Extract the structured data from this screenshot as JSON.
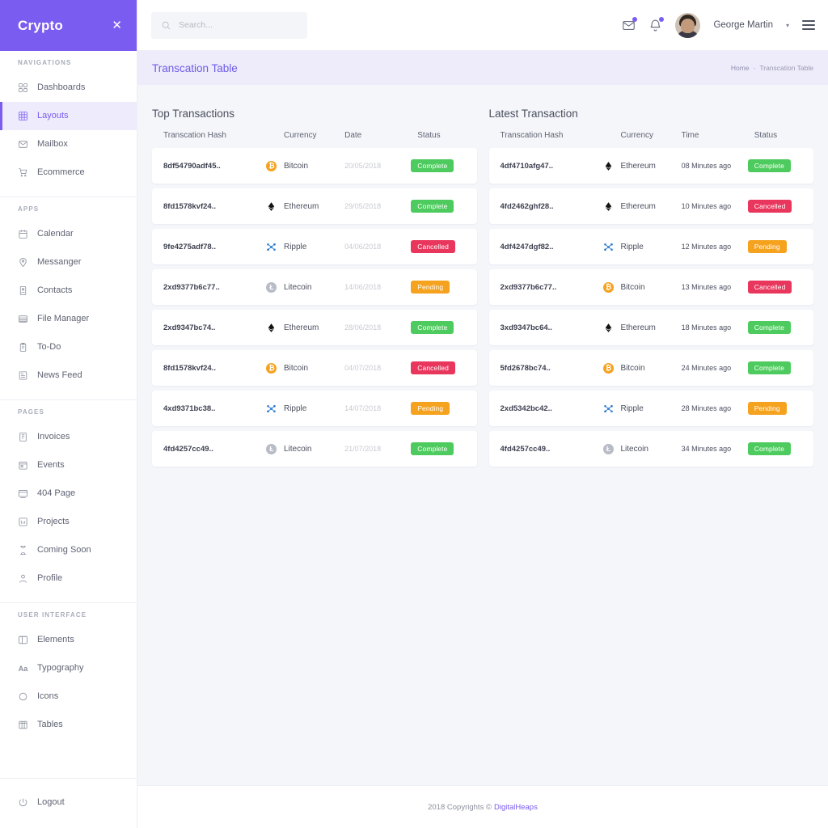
{
  "brand": {
    "name": "Crypto",
    "close_icon": "close-icon"
  },
  "sidebar": {
    "sections": [
      {
        "heading": "NAVIGATIONS",
        "items": [
          {
            "label": "Dashboards",
            "icon": "grid-icon",
            "active": false
          },
          {
            "label": "Layouts",
            "icon": "layout-grid-icon",
            "active": true
          },
          {
            "label": "Mailbox",
            "icon": "envelope-icon",
            "active": false
          },
          {
            "label": "Ecommerce",
            "icon": "cart-icon",
            "active": false
          }
        ]
      },
      {
        "heading": "APPS",
        "items": [
          {
            "label": "Calendar",
            "icon": "calendar-icon",
            "active": false
          },
          {
            "label": "Messanger",
            "icon": "chat-pin-icon",
            "active": false
          },
          {
            "label": "Contacts",
            "icon": "contact-card-icon",
            "active": false
          },
          {
            "label": "File Manager",
            "icon": "folder-lines-icon",
            "active": false
          },
          {
            "label": "To-Do",
            "icon": "clipboard-icon",
            "active": false
          },
          {
            "label": "News Feed",
            "icon": "news-icon",
            "active": false
          }
        ]
      },
      {
        "heading": "PAGES",
        "items": [
          {
            "label": "Invoices",
            "icon": "invoice-icon",
            "active": false
          },
          {
            "label": "Events",
            "icon": "events-icon",
            "active": false
          },
          {
            "label": "404 Page",
            "icon": "browser-error-icon",
            "active": false
          },
          {
            "label": "Projects",
            "icon": "projects-icon",
            "active": false
          },
          {
            "label": "Coming Soon",
            "icon": "hourglass-icon",
            "active": false
          },
          {
            "label": "Profile",
            "icon": "user-icon",
            "active": false
          }
        ]
      },
      {
        "heading": "USER INTERFACE",
        "items": [
          {
            "label": "Elements",
            "icon": "elements-icon",
            "active": false
          },
          {
            "label": "Typography",
            "icon": "typography-aa-icon",
            "active": false
          },
          {
            "label": "Icons",
            "icon": "circle-icon",
            "active": false
          },
          {
            "label": "Tables",
            "icon": "table-icon",
            "active": false
          }
        ]
      }
    ],
    "logout": {
      "label": "Logout",
      "icon": "power-icon"
    }
  },
  "header": {
    "search": {
      "placeholder": "Search...",
      "value": "",
      "icon": "search-icon"
    },
    "mail_icon": "envelope-icon",
    "bell_icon": "bell-icon",
    "user_name": "George Martin",
    "caret": "▾",
    "menu_icon": "hamburger-icon",
    "avatar": "avatar"
  },
  "breadcrumb": {
    "title": "Transcation Table",
    "home": "Home",
    "separator": "-",
    "current": "Transcation Table"
  },
  "left_table": {
    "title": "Top Transactions",
    "columns": [
      "Transcation Hash",
      "Currency",
      "Date",
      "Status"
    ],
    "rows": [
      {
        "hash": "8df54790adf45..",
        "currency": "Bitcoin",
        "coin": "btc",
        "date": "20/05/2018",
        "status": "Complete",
        "status_kind": "complete"
      },
      {
        "hash": "8fd1578kvf24..",
        "currency": "Ethereum",
        "coin": "eth",
        "date": "29/05/2018",
        "status": "Complete",
        "status_kind": "complete"
      },
      {
        "hash": "9fe4275adf78..",
        "currency": "Ripple",
        "coin": "xrp",
        "date": "04/06/2018",
        "status": "Cancelled",
        "status_kind": "cancelled"
      },
      {
        "hash": "2xd9377b6c77..",
        "currency": "Litecoin",
        "coin": "ltc",
        "date": "14/06/2018",
        "status": "Pending",
        "status_kind": "pending"
      },
      {
        "hash": "2xd9347bc74..",
        "currency": "Ethereum",
        "coin": "eth",
        "date": "28/06/2018",
        "status": "Complete",
        "status_kind": "complete"
      },
      {
        "hash": "8fd1578kvf24..",
        "currency": "Bitcoin",
        "coin": "btc",
        "date": "04/07/2018",
        "status": "Cancelled",
        "status_kind": "cancelled"
      },
      {
        "hash": "4xd9371bc38..",
        "currency": "Ripple",
        "coin": "xrp",
        "date": "14/07/2018",
        "status": "Pending",
        "status_kind": "pending"
      },
      {
        "hash": "4fd4257cc49..",
        "currency": "Litecoin",
        "coin": "ltc",
        "date": "21/07/2018",
        "status": "Complete",
        "status_kind": "complete"
      }
    ]
  },
  "right_table": {
    "title": "Latest Transaction",
    "columns": [
      "Transcation Hash",
      "Currency",
      "Time",
      "Status"
    ],
    "rows": [
      {
        "hash": "4df4710afg47..",
        "currency": "Ethereum",
        "coin": "eth",
        "date": "08 Minutes ago",
        "status": "Complete",
        "status_kind": "complete"
      },
      {
        "hash": "4fd2462ghf28..",
        "currency": "Ethereum",
        "coin": "eth",
        "date": "10 Minutes ago",
        "status": "Cancelled",
        "status_kind": "cancelled"
      },
      {
        "hash": "4df4247dgf82..",
        "currency": "Ripple",
        "coin": "xrp",
        "date": "12 Minutes ago",
        "status": "Pending",
        "status_kind": "pending"
      },
      {
        "hash": "2xd9377b6c77..",
        "currency": "Bitcoin",
        "coin": "btc",
        "date": "13 Minutes ago",
        "status": "Cancelled",
        "status_kind": "cancelled"
      },
      {
        "hash": "3xd9347bc64..",
        "currency": "Ethereum",
        "coin": "eth",
        "date": "18 Minutes ago",
        "status": "Complete",
        "status_kind": "complete"
      },
      {
        "hash": "5fd2678bc74..",
        "currency": "Bitcoin",
        "coin": "btc",
        "date": "24 Minutes ago",
        "status": "Complete",
        "status_kind": "complete"
      },
      {
        "hash": "2xd5342bc42..",
        "currency": "Ripple",
        "coin": "xrp",
        "date": "28 Minutes ago",
        "status": "Pending",
        "status_kind": "pending"
      },
      {
        "hash": "4fd4257cc49..",
        "currency": "Litecoin",
        "coin": "ltc",
        "date": "34 Minutes ago",
        "status": "Complete",
        "status_kind": "complete"
      }
    ]
  },
  "footer": {
    "text": "2018 Copyrights ©",
    "brand": "DigitalHeaps"
  },
  "colors": {
    "accent": "#7b5cf0",
    "crumb_bg": "#eeebfa",
    "content_bg": "#f4f6fa",
    "complete": "#4ecb5e",
    "cancelled": "#e8365d",
    "pending": "#f5a21f"
  }
}
